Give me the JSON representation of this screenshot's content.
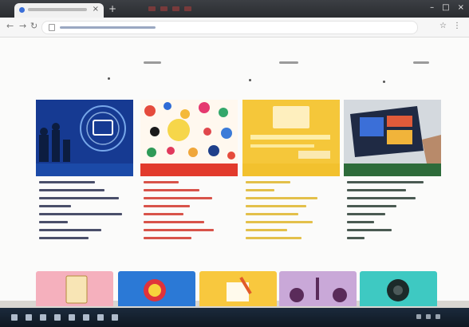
{
  "browser": {
    "tab_title": "",
    "new_tab_glyph": "+",
    "close_glyph": "×",
    "url": "",
    "window_controls": [
      "–",
      "□",
      "×"
    ]
  },
  "page": {
    "nav_items": [
      "",
      "",
      ""
    ],
    "cards": [
      {
        "heading": "",
        "color": "#1b4aa8",
        "links": [
          "",
          "",
          "",
          "",
          "",
          "",
          "",
          ""
        ]
      },
      {
        "heading": "",
        "color": "#e23a2c",
        "links": [
          "",
          "",
          "",
          "",
          "",
          "",
          "",
          ""
        ]
      },
      {
        "heading": "",
        "color": "#f2c12e",
        "links": [
          "",
          "",
          "",
          "",
          "",
          "",
          "",
          ""
        ]
      },
      {
        "heading": "",
        "color": "#2d6b3a",
        "links": [
          "",
          "",
          "",
          "",
          "",
          "",
          "",
          ""
        ]
      }
    ],
    "strip_colors": [
      "#f5b0bd",
      "#2b79d6",
      "#f8c83e",
      "#c9a8d8",
      "#3ec9c2"
    ]
  },
  "taskbar": {
    "clock": ""
  }
}
